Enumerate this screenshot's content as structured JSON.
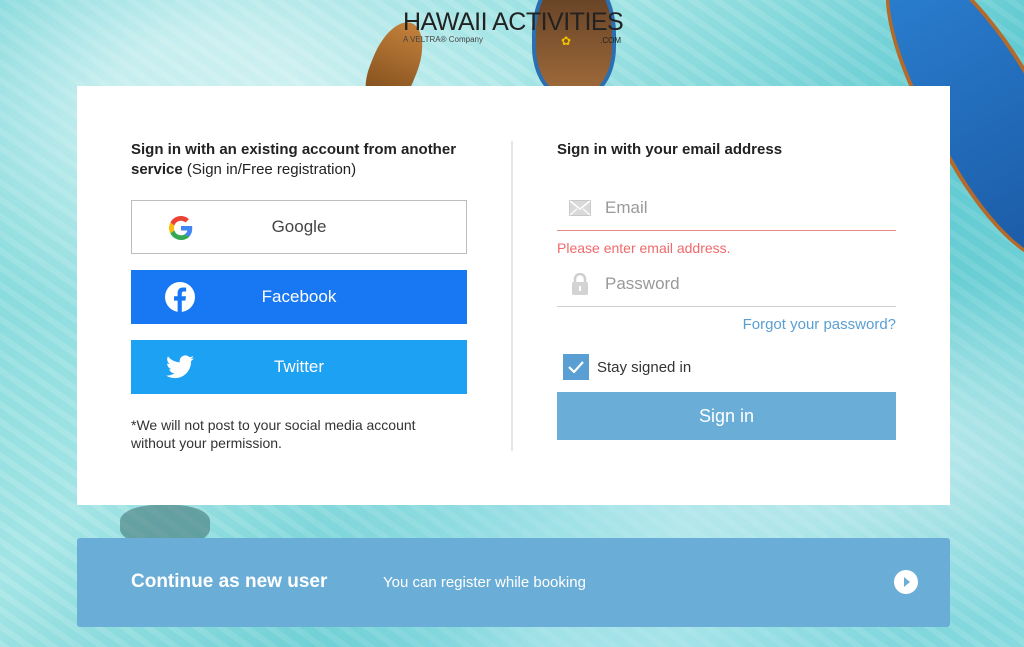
{
  "brand": {
    "logo_text": "HAWAII ACTIVITIES",
    "logo_sub": "A VELTRA® Company",
    "logo_com": ".COM"
  },
  "social": {
    "heading_bold": "Sign in with an existing account from another service",
    "heading_normal": " (Sign in/Free registration)",
    "google_label": "Google",
    "facebook_label": "Facebook",
    "twitter_label": "Twitter",
    "note": "*We will not post to your social media account without your permission."
  },
  "email_signin": {
    "heading": "Sign in with your email address",
    "email_placeholder": "Email",
    "email_value": "",
    "email_error": "Please enter email address.",
    "password_placeholder": "Password",
    "password_value": "",
    "forgot_label": "Forgot your password?",
    "stay_signed_in_label": "Stay signed in",
    "stay_signed_in_checked": true,
    "signin_label": "Sign in"
  },
  "new_user": {
    "title": "Continue as new user",
    "subtitle": "You can register while booking"
  },
  "colors": {
    "facebook": "#1877f2",
    "twitter": "#1da1f2",
    "primary": "#6aaed8",
    "error": "#f06a6a",
    "link": "#5a9fd4"
  }
}
